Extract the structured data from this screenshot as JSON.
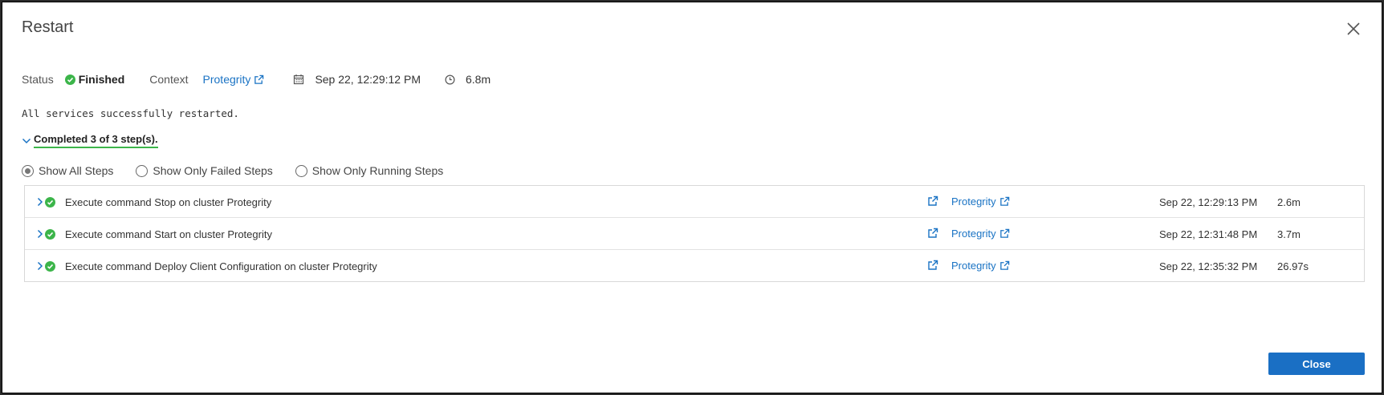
{
  "dialog": {
    "title": "Restart",
    "close_icon": "close-icon"
  },
  "status": {
    "label": "Status",
    "value": "Finished",
    "context_label": "Context",
    "context_link": "Protegrity",
    "start_time": "Sep 22, 12:29:12 PM",
    "duration": "6.8m",
    "colors": {
      "success": "#3cb54a",
      "link": "#1a73c4"
    }
  },
  "message": "All services successfully restarted.",
  "summary": "Completed 3 of 3 step(s).",
  "filters": {
    "options": [
      {
        "label": "Show All Steps",
        "selected": true
      },
      {
        "label": "Show Only Failed Steps",
        "selected": false
      },
      {
        "label": "Show Only Running Steps",
        "selected": false
      }
    ]
  },
  "steps": [
    {
      "name": "Execute command Stop on cluster Protegrity",
      "cluster": "Protegrity",
      "started": "Sep 22, 12:29:13 PM",
      "duration": "2.6m"
    },
    {
      "name": "Execute command Start on cluster Protegrity",
      "cluster": "Protegrity",
      "started": "Sep 22, 12:31:48 PM",
      "duration": "3.7m"
    },
    {
      "name": "Execute command Deploy Client Configuration on cluster Protegrity",
      "cluster": "Protegrity",
      "started": "Sep 22, 12:35:32 PM",
      "duration": "26.97s"
    }
  ],
  "footer": {
    "close_label": "Close",
    "button_color": "#1a6fc4"
  }
}
